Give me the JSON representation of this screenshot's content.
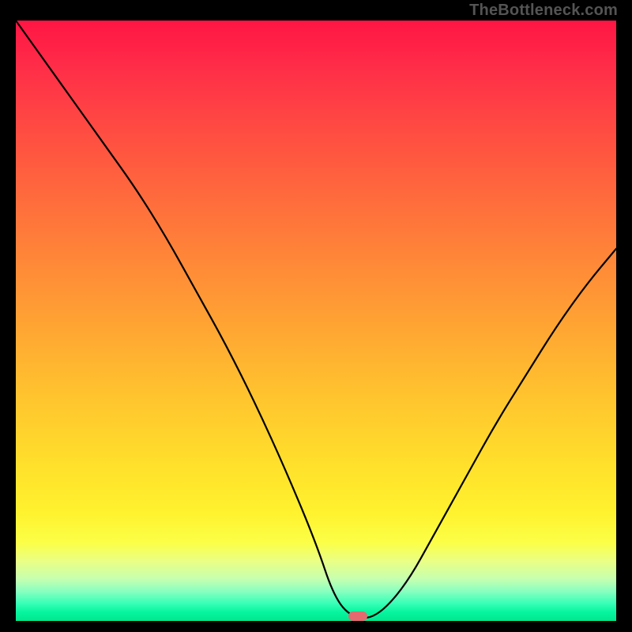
{
  "watermark": "TheBottleneck.com",
  "chart_data": {
    "type": "line",
    "title": "",
    "xlabel": "",
    "ylabel": "",
    "xlim": [
      0,
      100
    ],
    "ylim": [
      0,
      100
    ],
    "x": [
      0,
      5,
      10,
      15,
      20,
      25,
      30,
      35,
      40,
      45,
      50,
      53,
      56,
      60,
      65,
      70,
      75,
      80,
      85,
      90,
      95,
      100
    ],
    "values": [
      100,
      93,
      86,
      79,
      72,
      64,
      55,
      46,
      36,
      25,
      13,
      4,
      0.5,
      0.5,
      6,
      15,
      24,
      33,
      41,
      49,
      56,
      62
    ],
    "minimum_x": 57,
    "background_gradient": {
      "top": "#ff1544",
      "mid": "#ffd02c",
      "bottom": "#00e78d"
    },
    "marker": {
      "x": 57,
      "y": 0.5,
      "color": "#e46a6f"
    }
  }
}
